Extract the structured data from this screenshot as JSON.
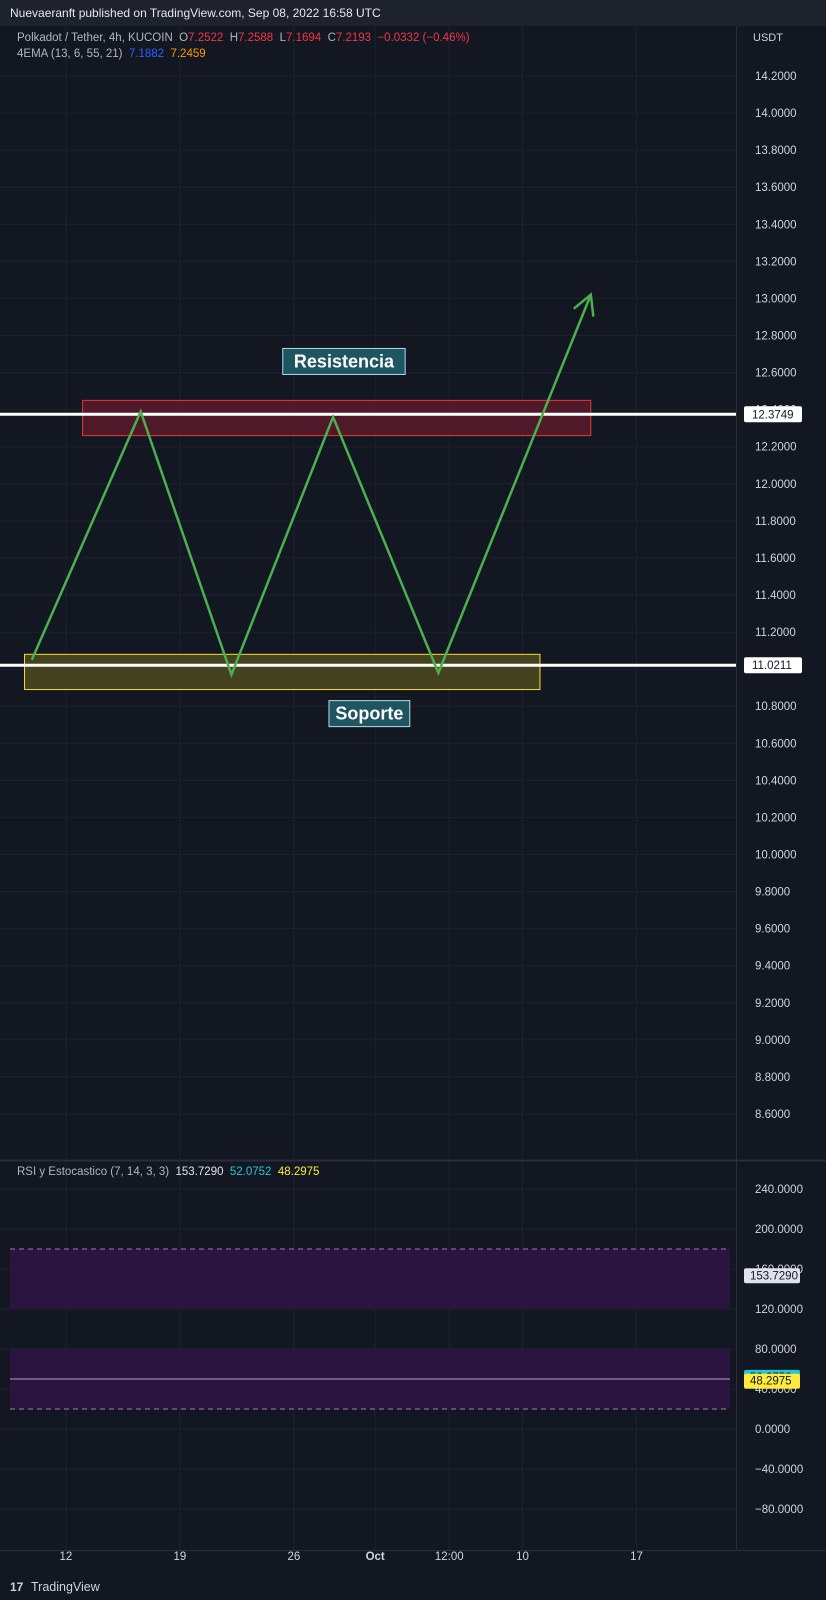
{
  "header": {
    "published": "Nuevaeranft published on TradingView.com, Sep 08, 2022 16:58 UTC"
  },
  "legend_main": {
    "symbol": "Polkadot / Tether, 4h, KUCOIN",
    "o_label": "O",
    "o_value": "7.2522",
    "h_label": "H",
    "h_value": "7.2588",
    "l_label": "L",
    "l_value": "7.1694",
    "c_label": "C",
    "c_value": "7.2193",
    "change": "−0.0332 (−0.46%)",
    "ema_label": "4EMA (13, 6, 55, 21)",
    "ema_value1": "7.1882",
    "ema_value2": "7.2459"
  },
  "legend_rsi": {
    "label": "RSI y Estocastico (7, 14, 3, 3)",
    "v1": "153.7290",
    "v2": "52.0752",
    "v3": "48.2975"
  },
  "chart_data": [
    {
      "type": "line",
      "currency_label": "USDT",
      "yticks": [
        "14.2000",
        "14.0000",
        "13.8000",
        "13.6000",
        "13.4000",
        "13.2000",
        "13.0000",
        "12.8000",
        "12.6000",
        "12.4000",
        "12.2000",
        "12.0000",
        "11.8000",
        "11.6000",
        "11.4000",
        "11.2000",
        "11.0000",
        "10.8000",
        "10.6000",
        "10.4000",
        "10.2000",
        "10.0000",
        "9.8000",
        "9.6000",
        "9.4000",
        "9.2000",
        "9.0000",
        "8.8000",
        "8.6000"
      ],
      "ylim": [
        8.5,
        14.4
      ],
      "xlim": [
        0,
        100
      ],
      "grid": true,
      "price_lines": [
        {
          "value": 12.3749,
          "label": "12.3749"
        },
        {
          "value": 11.0211,
          "label": "11.0211"
        }
      ],
      "zones": [
        {
          "name": "resistance-zone",
          "x": [
            10,
            80
          ],
          "y": [
            12.26,
            12.45
          ],
          "fill": "#5c1a2a",
          "stroke": "#e53935"
        },
        {
          "name": "support-zone",
          "x": [
            2,
            73
          ],
          "y": [
            10.89,
            11.08
          ],
          "fill": "#4d4a1f",
          "stroke": "#fdd835"
        }
      ],
      "annotations": [
        {
          "text": "Resistencia",
          "x": 46,
          "y": 12.66
        },
        {
          "text": "Soporte",
          "x": 49.5,
          "y": 10.76
        }
      ],
      "projection": {
        "color": "#4caf50",
        "points": [
          [
            3,
            11.05
          ],
          [
            18,
            12.39
          ],
          [
            30.5,
            10.97
          ],
          [
            44.5,
            12.36
          ],
          [
            59,
            10.98
          ],
          [
            80,
            13.02
          ]
        ],
        "arrow_tip": [
          80,
          13.02
        ]
      }
    },
    {
      "type": "line",
      "name": "RSI y Estocastico",
      "yticks": [
        "240.0000",
        "200.0000",
        "160.0000",
        "120.0000",
        "80.0000",
        "40.0000",
        "0.0000",
        "−40.0000",
        "−80.0000"
      ],
      "ylim": [
        -100,
        270
      ],
      "grid": true,
      "bands": [
        {
          "y": [
            120,
            180
          ],
          "fill": "#2b1540"
        },
        {
          "y": [
            20,
            80
          ],
          "fill": "#2b1540"
        }
      ],
      "hlines": [
        50
      ],
      "last_values": [
        {
          "value": 153.729,
          "label": "153.7290",
          "bg": "#e0e3eb",
          "fg": "#131722"
        },
        {
          "value": 52.0752,
          "label": "52.0752",
          "bg": "#26c6da",
          "fg": "#131722"
        },
        {
          "value": 48.2975,
          "label": "48.2975",
          "bg": "#ffeb3b",
          "fg": "#131722"
        }
      ]
    }
  ],
  "x_axis": {
    "ticks": [
      {
        "label": "12",
        "pos": 7.7,
        "bold": false
      },
      {
        "label": "19",
        "pos": 23.4,
        "bold": false
      },
      {
        "label": "26",
        "pos": 39.1,
        "bold": false
      },
      {
        "label": "Oct",
        "pos": 50.3,
        "bold": true
      },
      {
        "label": "12:00",
        "pos": 60.5,
        "bold": false
      },
      {
        "label": "10",
        "pos": 70.6,
        "bold": false
      },
      {
        "label": "17",
        "pos": 86.3,
        "bold": false
      }
    ]
  },
  "footer": {
    "brand": "TradingView",
    "logo": "17"
  }
}
